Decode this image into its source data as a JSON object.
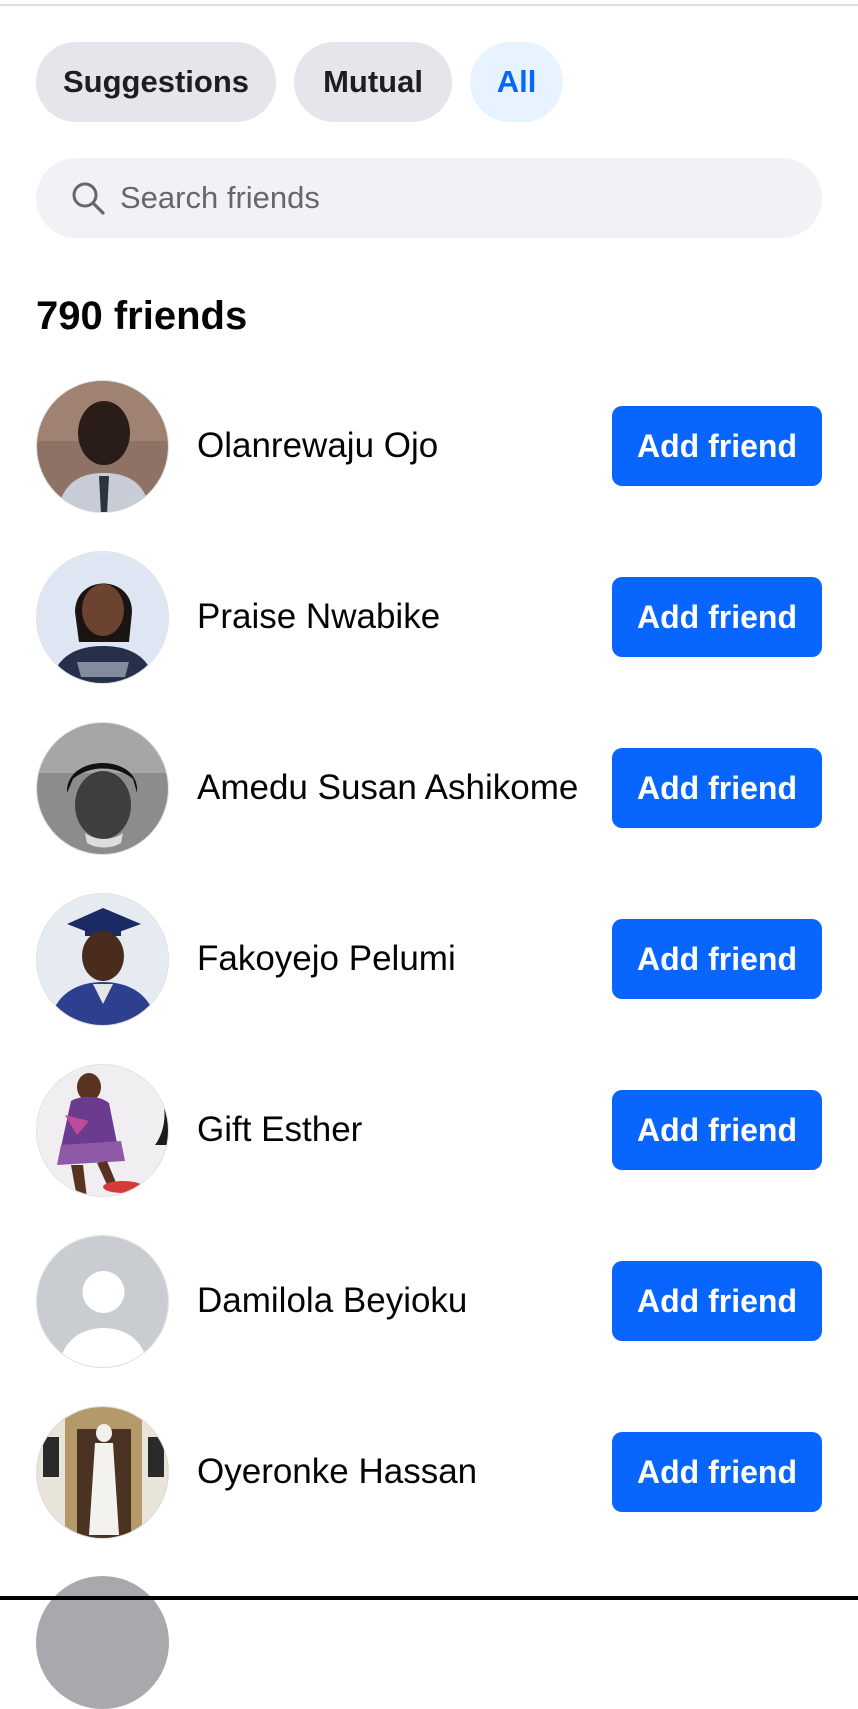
{
  "filters": {
    "chips": [
      {
        "label": "Suggestions",
        "active": false
      },
      {
        "label": "Mutual",
        "active": false
      },
      {
        "label": "All",
        "active": true
      }
    ]
  },
  "search": {
    "placeholder": "Search friends",
    "value": "",
    "icon": "search-icon"
  },
  "friends_count_label": "790 friends",
  "friends": [
    {
      "name": "Olanrewaju Ojo",
      "button_label": "Add friend",
      "avatar": "photo"
    },
    {
      "name": "Praise Nwabike",
      "button_label": "Add friend",
      "avatar": "photo"
    },
    {
      "name": "Amedu Susan Ashikome",
      "button_label": "Add friend",
      "avatar": "photo"
    },
    {
      "name": "Fakoyejo Pelumi",
      "button_label": "Add friend",
      "avatar": "photo"
    },
    {
      "name": "Gift Esther",
      "button_label": "Add friend",
      "avatar": "photo"
    },
    {
      "name": "Damilola Beyioku",
      "button_label": "Add friend",
      "avatar": "default-silhouette"
    },
    {
      "name": "Oyeronke Hassan",
      "button_label": "Add friend",
      "avatar": "photo"
    }
  ],
  "colors": {
    "primary_blue": "#0866ff",
    "chip_bg": "#e4e6eb",
    "active_chip_bg": "#e7f3ff",
    "search_bg": "#f0f2f5"
  }
}
